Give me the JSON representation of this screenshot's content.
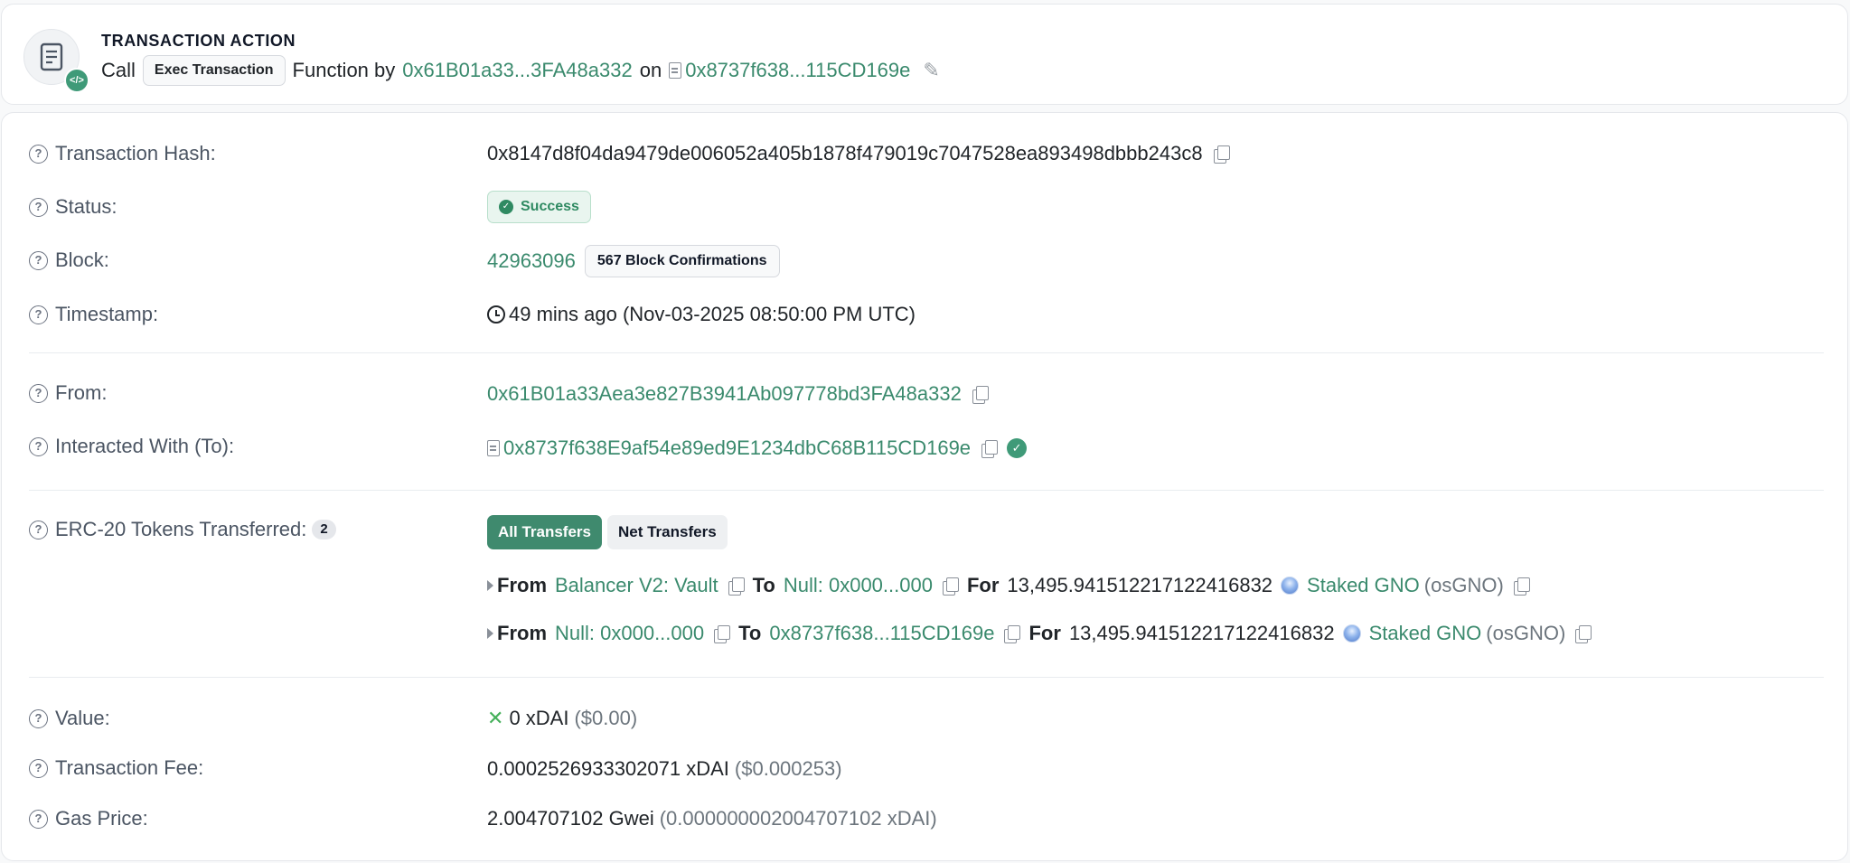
{
  "action": {
    "heading": "TRANSACTION ACTION",
    "call_word": "Call",
    "method": "Exec Transaction",
    "function_by": "Function by",
    "caller": "0x61B01a33...3FA48a332",
    "on_word": "on",
    "contract": "0x8737f638...115CD169e",
    "icon": "document-icon",
    "badge_icon": "code-icon",
    "badge_glyph": "</>"
  },
  "details": {
    "tx_hash": {
      "label": "Transaction Hash:",
      "value": "0x8147d8f04da9479de006052a405b1878f479019c7047528ea893498dbbb243c8"
    },
    "status": {
      "label": "Status:",
      "value": "Success"
    },
    "block": {
      "label": "Block:",
      "number": "42963096",
      "confirmations": "567 Block Confirmations"
    },
    "timestamp": {
      "label": "Timestamp:",
      "value": "49 mins ago (Nov-03-2025 08:50:00 PM UTC)"
    },
    "from": {
      "label": "From:",
      "value": "0x61B01a33Aea3e827B3941Ab097778bd3FA48a332"
    },
    "to": {
      "label": "Interacted With (To):",
      "value": "0x8737f638E9af54e89ed9E1234dbC68B115CD169e"
    },
    "erc20": {
      "label": "ERC-20 Tokens Transferred:",
      "count": "2",
      "tabs": {
        "all": "All Transfers",
        "net": "Net Transfers"
      },
      "transfers": [
        {
          "from_word": "From",
          "from": "Balancer V2: Vault",
          "to_word": "To",
          "to": "Null: 0x000...000",
          "for_word": "For",
          "amount": "13,495.941512217122416832",
          "token": "Staked GNO",
          "symbol": "(osGNO)"
        },
        {
          "from_word": "From",
          "from": "Null: 0x000...000",
          "to_word": "To",
          "to": "0x8737f638...115CD169e",
          "for_word": "For",
          "amount": "13,495.941512217122416832",
          "token": "Staked GNO",
          "symbol": "(osGNO)"
        }
      ]
    },
    "value": {
      "label": "Value:",
      "amount": "0 xDAI",
      "usd": "($0.00)"
    },
    "fee": {
      "label": "Transaction Fee:",
      "amount": "0.0002526933302071 xDAI",
      "usd": "($0.000253)"
    },
    "gas_price": {
      "label": "Gas Price:",
      "amount": "2.004707102 Gwei",
      "sub": "(0.000000002004707102 xDAI)"
    }
  },
  "colors": {
    "link": "#3a8a6d",
    "success": "#2f8a62",
    "accent": "#3f8a6e"
  }
}
